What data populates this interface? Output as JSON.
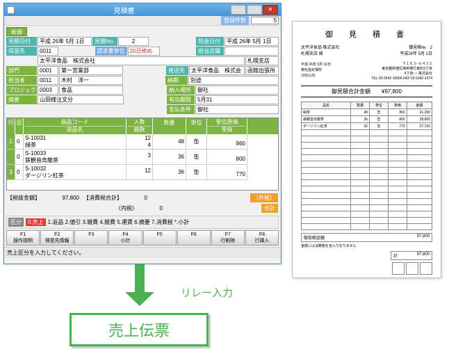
{
  "window": {
    "title": "見積書",
    "reg_count_label": "登録件数",
    "reg_count": "5"
  },
  "form": {
    "new_btn": "新規",
    "date_lbl": "見積日付",
    "date_val": "平成 26年 5月 1日",
    "no_lbl": "見積No.",
    "no_val": "2",
    "inqdate_lbl": "照会日付",
    "inqdate_val": "平成 26年 5月 1日",
    "cust_lbl": "得意先",
    "cust_cd": "0011",
    "billunit_lbl": "請求書単位",
    "billunit_val": "20日締め",
    "deptstore_lbl": "担当店舗",
    "cust_nm": "太平洋食品　株式会社",
    "cust_br": "札幌支店",
    "dept_lbl": "部門",
    "dept_cd": "0001",
    "dept_nm": "第一営業部",
    "ship_lbl": "直送先",
    "ship_nm": "太平洋食品　株式会",
    "ship_br": "函館出張所",
    "pic_lbl": "担当者",
    "pic_cd": "0011",
    "pic_nm": "木村　洋一",
    "proj_lbl": "プロジェクト",
    "proj_cd": "0003",
    "proj_nm": "食品",
    "delivdate_lbl": "納期",
    "delivdate_val": "別途",
    "memo_lbl": "摘要",
    "memo_val": "山田様注文分",
    "delivplace_lbl": "納入場所",
    "delivplace_val": "御社",
    "valid_lbl": "有効期限",
    "valid_val": "5月31",
    "pay_lbl": "支払条件",
    "pay_val": "御社"
  },
  "grid": {
    "h_no": "行",
    "h_ku": "区",
    "h_code": "商品コード",
    "h_name": "商品名",
    "h_qty1": "入数",
    "h_qty2": "箱数",
    "h_num": "数量",
    "h_unit": "単位",
    "h_uprice": "単位原価",
    "h_price": "単価",
    "rows": [
      {
        "no": "1",
        "ku": "0",
        "code": "S-10031",
        "name": "緑茶",
        "q1": "12",
        "q2": "4",
        "num": "48",
        "unit": "缶",
        "price": "860"
      },
      {
        "no": "",
        "ku": "0",
        "code": "S-10033",
        "name": "鉄観音烏龍茶",
        "q1": "3",
        "q2": "",
        "num": "36",
        "unit": "缶",
        "price": "800"
      },
      {
        "no": "3",
        "ku": "0",
        "code": "S-10032",
        "name": "ダージリン紅茶",
        "q1": "12",
        "q2": "",
        "num": "36",
        "unit": "缶",
        "price": "770"
      }
    ]
  },
  "totals": {
    "pretax_lbl": "【税抜金額】",
    "pretax": "97,800",
    "tax_lbl": "【消費税合計】",
    "tax": "0",
    "inner_lbl": "〈内税〉",
    "inner": "0",
    "ext_lbl": "〈外税〉",
    "ext_val": "合計"
  },
  "kubun": {
    "lbl": "区分",
    "cur": "0.売上",
    "rest": "1.返品 2.値引 3.雑費 4.雑費 5.運賃 6.摘要 7.消費税 *.小計"
  },
  "fkeys": {
    "f1": "F1\n操作説明",
    "f2": "F2\n得意先情報",
    "f3": "F3",
    "f4": "F4\n小計",
    "f5": "F5",
    "f6": "F6",
    "f7": "F7\n行削除",
    "f8": "F8\n行挿入"
  },
  "status": "売上区分を入力してください。",
  "doc": {
    "title": "御　見　積　書",
    "to": "太平洋食品 株式会社\n札幌支店 様",
    "no": "御見積№　2",
    "date": "平成26年 5月 1日",
    "from_name": "株式会社○○○",
    "from_addr": "〒１６３−０４３２\n東京都新宿区西新宿行幸町3丁目\n4丁目○○ 株式会社\nTEL 03-5542-10666  FAX 03-5342-1074",
    "cond1": "平成 26年 5月 10日",
    "cond2": "御社指定場所",
    "cond3": "10日以内",
    "amt_lbl": "御見積合計金額",
    "amt": "¥97,800",
    "cols": [
      "品名",
      "数量",
      "単位",
      "単価",
      "金額"
    ],
    "lines": [
      {
        "n": "緑茶",
        "q": "48",
        "u": "缶",
        "p": "860",
        "a": "41,280"
      },
      {
        "n": "鉄観音烏龍茶",
        "q": "36",
        "u": "缶",
        "p": "800",
        "a": "28,800"
      },
      {
        "n": "ダージリン紅茶",
        "q": "36",
        "u": "缶",
        "p": "770",
        "a": "27,720"
      }
    ],
    "sum_lbl": "御見積金額",
    "sum": "97,800",
    "note": "金額には消費税を含んでおりません",
    "total_lbl": "計",
    "total": "97,800"
  },
  "relay_label": "リレー入力",
  "target_label": "売上伝票"
}
